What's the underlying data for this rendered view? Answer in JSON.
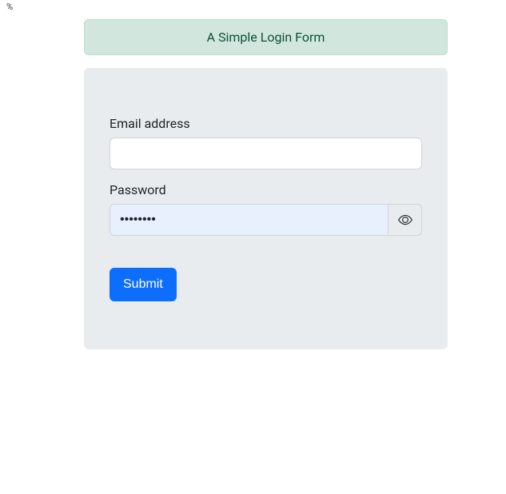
{
  "corner_text": "%",
  "header": {
    "title": "A Simple Login Form"
  },
  "form": {
    "email": {
      "label": "Email address",
      "value": ""
    },
    "password": {
      "label": "Password",
      "value": "••••••••"
    },
    "submit_label": "Submit"
  }
}
